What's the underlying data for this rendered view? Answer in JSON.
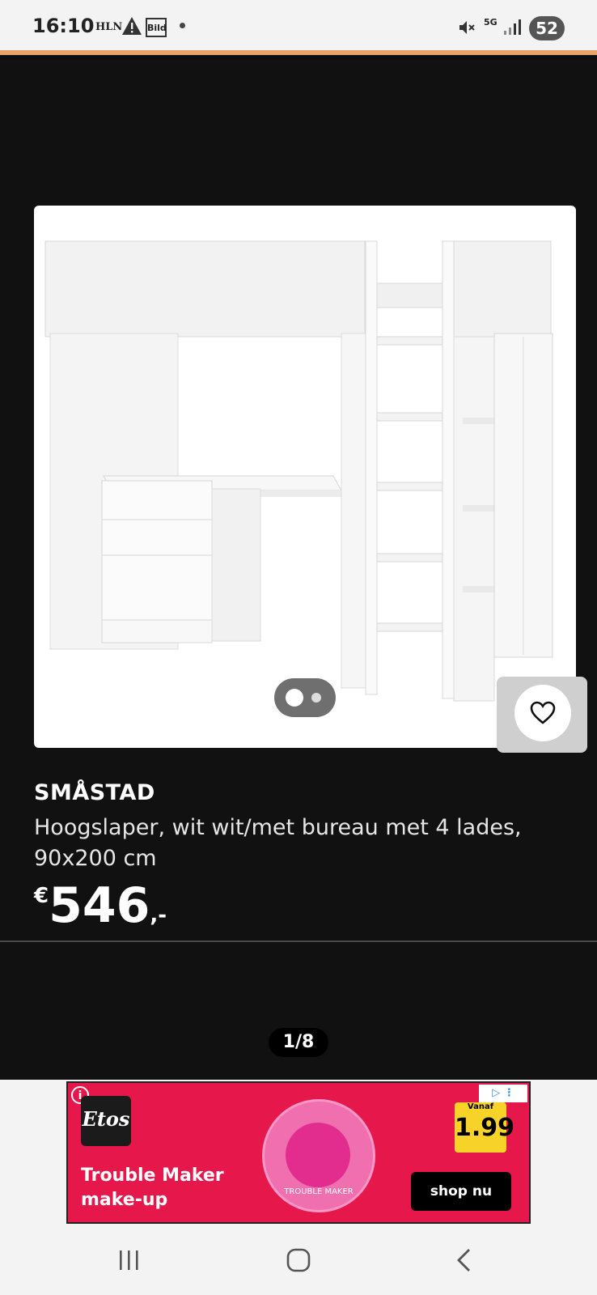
{
  "status_bar": {
    "time": "16:10",
    "app_icon_hln": "HLN",
    "app_icon_bild": "Bild",
    "network": "5G",
    "battery": "52"
  },
  "product": {
    "brand": "SMÅSTAD",
    "description": "Hoogslaper, wit wit/met bureau met 4 lades, 90x200 cm",
    "price_currency": "€",
    "price_amount": "546",
    "price_suffix": ",-"
  },
  "gallery": {
    "pager": "1/8"
  },
  "ad": {
    "brand": "Etos",
    "title": "Trouble Maker make-up",
    "product_label": "TROUBLE MAKER",
    "price_label": "Vanaf",
    "price": "1.99",
    "cta": "shop nu"
  },
  "colors": {
    "background": "#111111",
    "ad_background": "#e5174b",
    "status_accent": "#e8a46a"
  }
}
